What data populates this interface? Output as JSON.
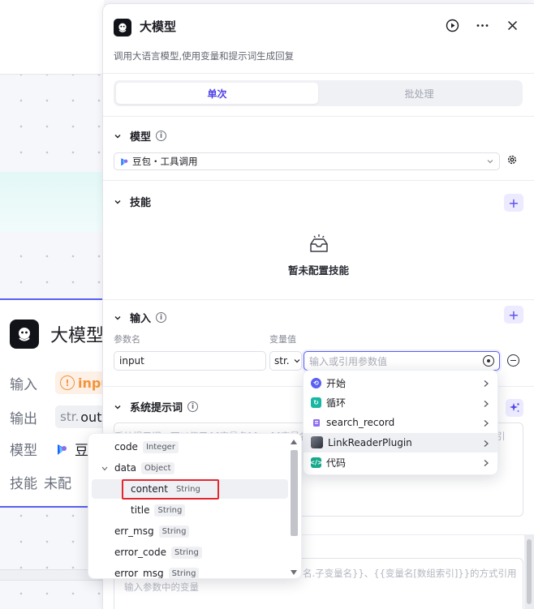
{
  "node": {
    "title": "大模型",
    "rows": [
      {
        "label": "输入",
        "value": "inpu"
      },
      {
        "label": "输出",
        "type": "str.",
        "value": "outp"
      },
      {
        "label": "模型",
        "value": "豆"
      },
      {
        "label": "技能",
        "value": "未配"
      }
    ]
  },
  "panel": {
    "title": "大模型",
    "description": "调用大语言模型,使用变量和提示词生成回复",
    "icons": [
      "play-icon",
      "more-icon",
      "close-icon"
    ],
    "tabs": [
      {
        "label": "单次",
        "active": true
      },
      {
        "label": "批处理",
        "active": false
      }
    ],
    "model_section": {
      "title": "模型",
      "selected": "豆包・工具调用"
    },
    "skill_section": {
      "title": "技能",
      "empty_text": "暂未配置技能"
    },
    "input_section": {
      "title": "输入",
      "col_name": "参数名",
      "col_value": "变量值",
      "param_name": "input",
      "type": "str.",
      "value_placeholder": "输入或引用参数值"
    },
    "system_prompt_section": {
      "title": "系统提示词",
      "hint": "系统提示词，可以使用{{变量名}}、{{变量名",
      "hint_right": "引"
    },
    "user_prompt": {
      "hint_line1": "名.子变量名}}、{{变量名[数组索引]}}的方式引用",
      "hint_line2": "输入参数中的变量"
    }
  },
  "variable_menu": {
    "items": [
      {
        "label": "开始",
        "icon": "start-icon",
        "color": "#5b5ff2"
      },
      {
        "label": "循环",
        "icon": "loop-icon",
        "color": "#17b7a4"
      },
      {
        "label": "search_record",
        "icon": "database-icon",
        "color": "#8e6cf0"
      },
      {
        "label": "LinkReaderPlugin",
        "icon": "plugin-avatar-icon",
        "color": "#3a3f4a"
      },
      {
        "label": "代码",
        "icon": "code-icon",
        "color": "#16a98c"
      }
    ],
    "hovered": "LinkReaderPlugin"
  },
  "tree_menu": {
    "rows": [
      {
        "name": "code",
        "type": "Integer",
        "level": 0
      },
      {
        "name": "data",
        "type": "Object",
        "level": 0,
        "expanded": true
      },
      {
        "name": "content",
        "type": "String",
        "level": 1,
        "selected": true
      },
      {
        "name": "title",
        "type": "String",
        "level": 1
      },
      {
        "name": "err_msg",
        "type": "String",
        "level": 0
      },
      {
        "name": "error_code",
        "type": "String",
        "level": 0
      },
      {
        "name": "error_msg",
        "type": "String",
        "level": 0
      }
    ]
  },
  "colors": {
    "accent": "#5b5ff2",
    "highlight_box": "#e4272e",
    "warning": "#f4943a"
  }
}
